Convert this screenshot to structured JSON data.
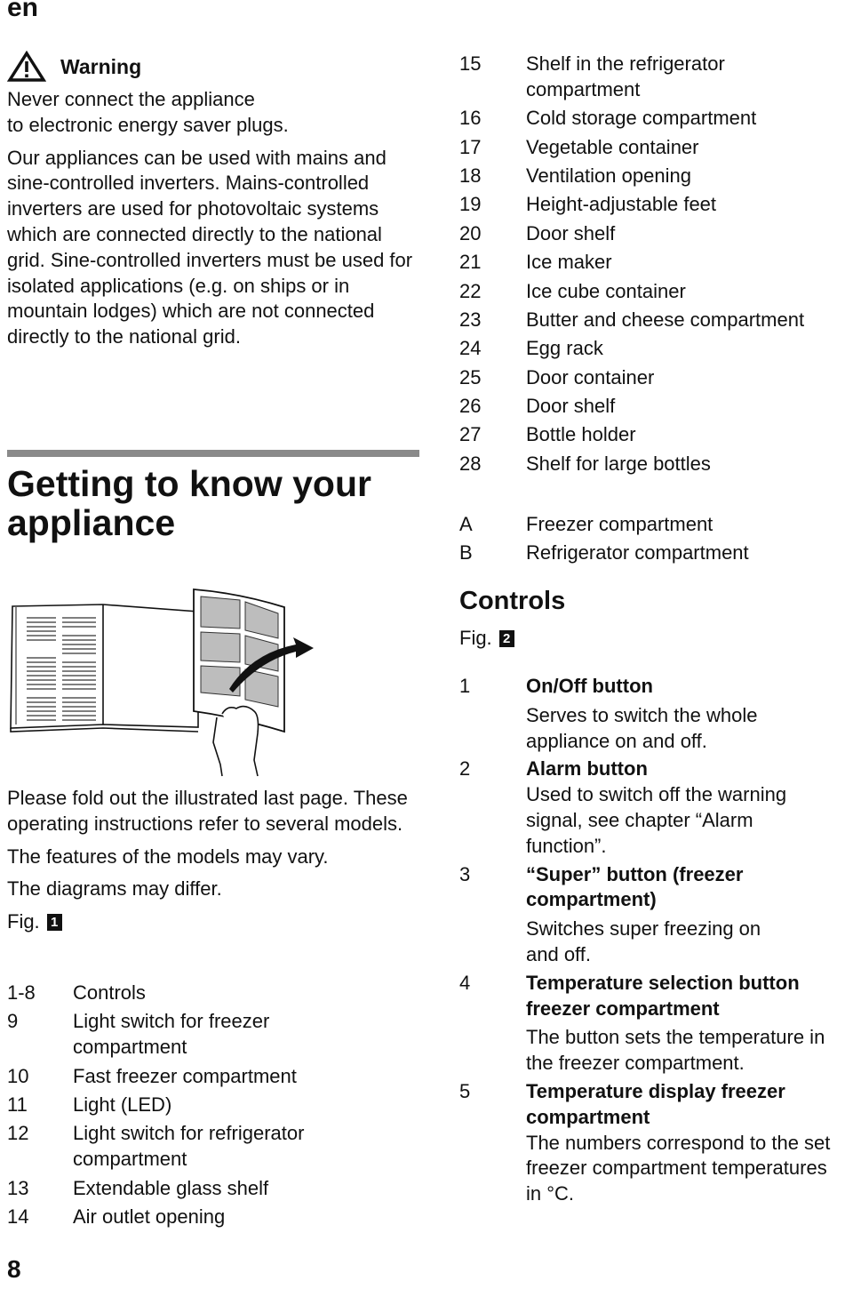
{
  "header": {
    "language": "en"
  },
  "warning": {
    "icon": "warning-triangle-icon",
    "title": "Warning",
    "paragraphs": [
      "Never connect the appliance\nto electronic energy saver plugs.",
      "Our appliances can be used with mains and sine-controlled inverters. Mains-controlled inverters are used for photovoltaic systems which are connected directly to the national grid. Sine-controlled inverters must be used for isolated applications (e.g. on ships or in mountain lodges) which are not connected directly to the national grid."
    ]
  },
  "section": {
    "title": "Getting to know your appliance",
    "illustration": "fold-out-manual-illustration",
    "paragraphs": [
      "Please fold out the illustrated last page. These operating instructions refer to several models.",
      "The features of the models may vary.",
      "The diagrams may differ."
    ],
    "fig_label": "Fig.",
    "fig_number": "1"
  },
  "components": [
    {
      "num": "1-8",
      "label": "Controls"
    },
    {
      "num": "9",
      "label": "Light switch for freezer compartment"
    },
    {
      "num": "10",
      "label": "Fast freezer compartment"
    },
    {
      "num": "11",
      "label": "Light (LED)"
    },
    {
      "num": "12",
      "label": "Light switch for refrigerator compartment"
    },
    {
      "num": "13",
      "label": "Extendable glass shelf"
    },
    {
      "num": "14",
      "label": "Air outlet opening"
    },
    {
      "num": "15",
      "label": "Shelf in the refrigerator compartment"
    },
    {
      "num": "16",
      "label": "Cold storage compartment"
    },
    {
      "num": "17",
      "label": "Vegetable container"
    },
    {
      "num": "18",
      "label": "Ventilation opening"
    },
    {
      "num": "19",
      "label": "Height-adjustable feet"
    },
    {
      "num": "20",
      "label": "Door shelf"
    },
    {
      "num": "21",
      "label": "Ice maker"
    },
    {
      "num": "22",
      "label": "Ice cube container"
    },
    {
      "num": "23",
      "label": "Butter and cheese compartment"
    },
    {
      "num": "24",
      "label": "Egg rack"
    },
    {
      "num": "25",
      "label": "Door container"
    },
    {
      "num": "26",
      "label": "Door shelf"
    },
    {
      "num": "27",
      "label": "Bottle holder"
    },
    {
      "num": "28",
      "label": "Shelf for large bottles"
    }
  ],
  "compartments": [
    {
      "num": "A",
      "label": "Freezer compartment"
    },
    {
      "num": "B",
      "label": "Refrigerator compartment"
    }
  ],
  "controls": {
    "title": "Controls",
    "fig_label": "Fig.",
    "fig_number": "2",
    "items": [
      {
        "num": "1",
        "title": "On/Off button",
        "desc": "Serves to switch the whole appliance on and off."
      },
      {
        "num": "2",
        "title": "Alarm button",
        "desc": "Used to switch off the warning signal, see chapter “Alarm function”."
      },
      {
        "num": "3",
        "title": "“Super” button (freezer compartment)",
        "desc": "Switches super freezing on and off."
      },
      {
        "num": "4",
        "title": "Temperature selection button freezer compartment",
        "desc": "The button sets the temperature in the freezer compartment."
      },
      {
        "num": "5",
        "title": "Temperature display freezer compartment",
        "desc": "The numbers correspond to the set freezer compartment temperatures in °C."
      }
    ]
  },
  "footer": {
    "page_number": "8"
  }
}
